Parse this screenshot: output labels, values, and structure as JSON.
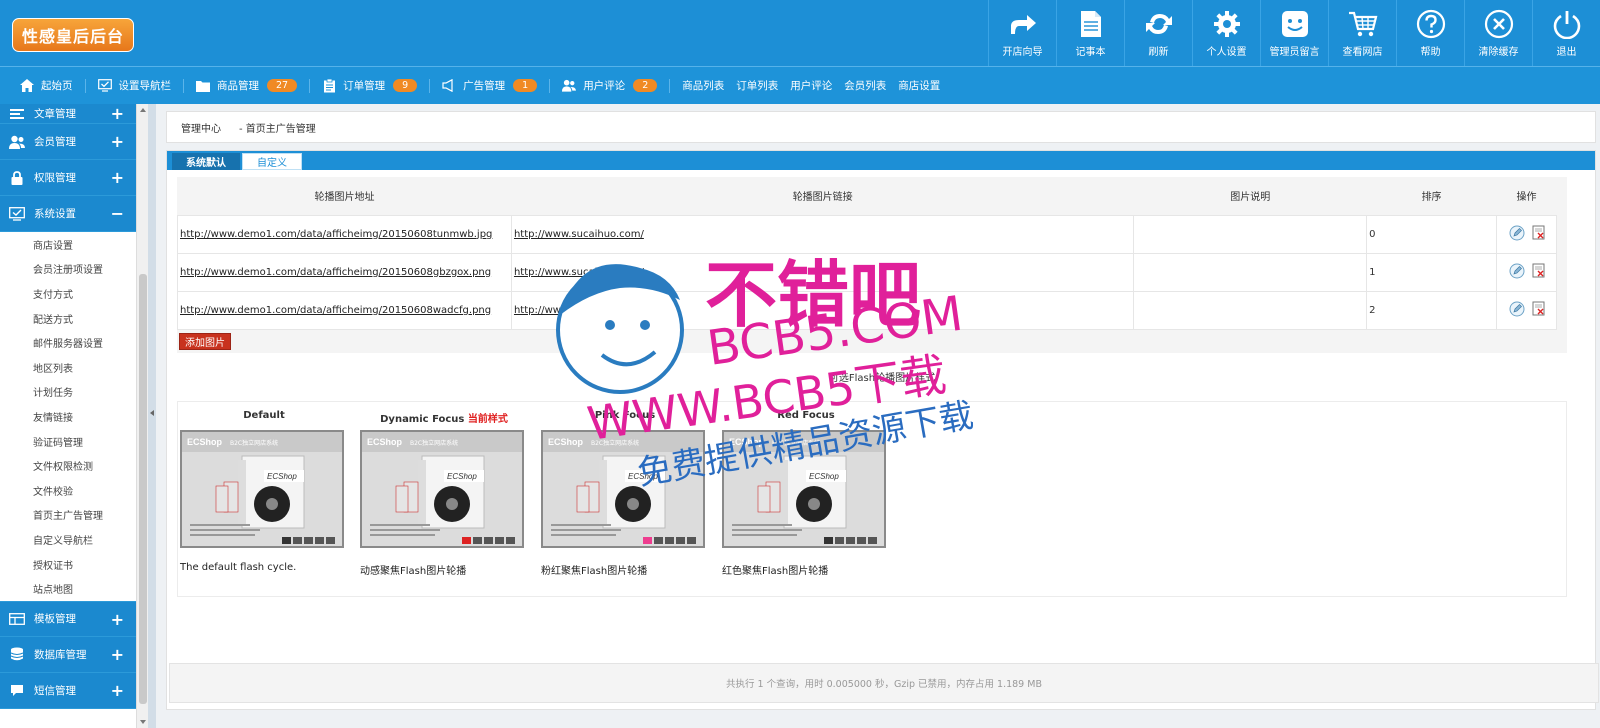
{
  "app": {
    "logo_text": "性感皇后后台"
  },
  "topnav": [
    {
      "label": "开店向导",
      "icon": "share-arrow-icon"
    },
    {
      "label": "记事本",
      "icon": "notepad-icon"
    },
    {
      "label": "刷新",
      "icon": "refresh-icon"
    },
    {
      "label": "个人设置",
      "icon": "gear-icon"
    },
    {
      "label": "管理员留言",
      "icon": "smiley-icon"
    },
    {
      "label": "查看网店",
      "icon": "cart-icon"
    },
    {
      "label": "帮助",
      "icon": "help-icon"
    },
    {
      "label": "清除缓存",
      "icon": "close-circle-icon"
    },
    {
      "label": "退出",
      "icon": "power-icon"
    }
  ],
  "navbar2": {
    "home": "起始页",
    "nav_settings": "设置导航栏",
    "products": {
      "label": "商品管理",
      "count": "27"
    },
    "orders": {
      "label": "订单管理",
      "count": "9"
    },
    "ads": {
      "label": "广告管理",
      "count": "1"
    },
    "reviews": {
      "label": "用户评论",
      "count": "2"
    },
    "links": [
      "商品列表",
      "订单列表",
      "用户评论",
      "会员列表",
      "商店设置"
    ]
  },
  "sidebar": {
    "top_groups": [
      {
        "label": "文章管理",
        "toggle": "+"
      },
      {
        "label": "会员管理",
        "toggle": "+"
      },
      {
        "label": "权限管理",
        "toggle": "+"
      },
      {
        "label": "系统设置",
        "toggle": "−"
      }
    ],
    "sub_items": [
      "商店设置",
      "会员注册项设置",
      "支付方式",
      "配送方式",
      "邮件服务器设置",
      "地区列表",
      "计划任务",
      "友情链接",
      "验证码管理",
      "文件权限检测",
      "文件校验",
      "首页主广告管理",
      "自定义导航栏",
      "授权证书",
      "站点地图"
    ],
    "bottom_groups": [
      {
        "label": "模板管理",
        "toggle": "+"
      },
      {
        "label": "数据库管理",
        "toggle": "+"
      },
      {
        "label": "短信管理",
        "toggle": "+"
      }
    ]
  },
  "breadcrumb": {
    "root": "管理中心",
    "current": "- 首页主广告管理"
  },
  "tabs": {
    "active": "系统默认",
    "other": "自定义"
  },
  "table": {
    "headers": [
      "轮播图片地址",
      "轮播图片链接",
      "图片说明",
      "排序",
      "操作"
    ],
    "rows": [
      {
        "img": "http://www.demo1.com/data/afficheimg/20150608tunmwb.jpg",
        "link": "http://www.sucaihuo.com/",
        "desc": "",
        "sort": "0"
      },
      {
        "img": "http://www.demo1.com/data/afficheimg/20150608gbzgox.png",
        "link": "http://www.sucaihuo.com/",
        "desc": "",
        "sort": "1"
      },
      {
        "img": "http://www.demo1.com/data/afficheimg/20150608wadcfg.png",
        "link": "http://www.sucaihuo.com/",
        "desc": "",
        "sort": "2"
      }
    ],
    "add_button": "添加图片"
  },
  "flash_section_title": "可选Flash轮播图片样式",
  "styles": [
    {
      "name": "Default",
      "current_tag": "",
      "desc": "The default flash cycle."
    },
    {
      "name": "Dynamic Focus",
      "current_tag": "当前样式",
      "desc": "动感聚焦Flash图片轮播"
    },
    {
      "name": "Pink Focus",
      "current_tag": "",
      "desc": "粉红聚焦Flash图片轮播"
    },
    {
      "name": "Red Focus",
      "current_tag": "",
      "desc": "红色聚焦Flash图片轮播"
    }
  ],
  "thumb": {
    "brand": "ECShop",
    "tagline": "B2C独立网店系统"
  },
  "footer": "共执行 1 个查询，用时 0.005000 秒，Gzip 已禁用，内存占用 1.189 MB",
  "watermark": {
    "line1": "不错吧",
    "line2": "BCB5.COM",
    "line3": "WWW.BCB5下载",
    "line4": "免费提供精品资源下载"
  },
  "colors": {
    "primary": "#1d8fd6",
    "badge": "#f08a24",
    "danger": "#c8321e",
    "current": "#e02020",
    "watermark": "#e0209a"
  }
}
